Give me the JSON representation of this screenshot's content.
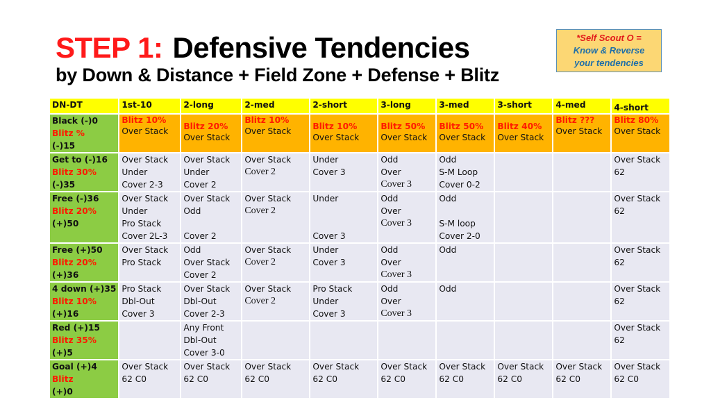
{
  "header": {
    "step": "STEP 1:",
    "title": "Defensive Tendencies",
    "subtitle": "by Down & Distance + Field Zone + Defense + Blitz"
  },
  "note": {
    "line1": "*Self Scout O =",
    "line2": "Know & Reverse",
    "line3": "your tendencies"
  },
  "colors": {
    "header_row": "#ffff00",
    "blitz_row": "#ffb300",
    "row_label": "#8ccc44",
    "cell": "#e8e8f2",
    "blitz_text": "#ff1a00",
    "title_step": "#ff1a1a"
  },
  "table": {
    "columns": [
      "DN-DT",
      "1st-10",
      "2-long",
      "2-med",
      "2-short",
      "3-long",
      "3-med",
      "3-short",
      "4-med",
      "4-short"
    ],
    "rows": [
      {
        "zone": "Black (-)0",
        "blitz": "Blitz %",
        "range": "(-)15",
        "cells": [
          [
            "Blitz 10%",
            "Over Stack"
          ],
          [
            "Blitz 20%",
            "Over Stack"
          ],
          [
            "Blitz 10%",
            "Over Stack"
          ],
          [
            "Blitz 10%",
            "Over Stack"
          ],
          [
            "Blitz 50%",
            "Over Stack"
          ],
          [
            "Blitz 50%",
            "Over Stack"
          ],
          [
            "Blitz 40%",
            "Over Stack"
          ],
          [
            "Blitz ???",
            "Over Stack"
          ],
          [
            "Blitz 80%",
            "Over Stack"
          ]
        ]
      },
      {
        "zone": "Get to (-)16",
        "blitz": "Blitz 30%",
        "range": "(-)35",
        "cells": [
          [
            "Over Stack",
            "Under",
            "Cover 2-3"
          ],
          [
            "Over Stack",
            "Under",
            "Cover 2"
          ],
          [
            "Over Stack",
            "Cover 2"
          ],
          [
            "Under",
            "Cover 3"
          ],
          [
            "Odd",
            "Over",
            "Cover 3"
          ],
          [
            "Odd",
            "S-M Loop",
            "Cover 0-2"
          ],
          [],
          [],
          [
            "Over Stack",
            "62"
          ]
        ]
      },
      {
        "zone": "Free (-)36",
        "blitz": "Blitz 20%",
        "range": "(+)50",
        "cells": [
          [
            "Over Stack",
            "Under",
            "Pro Stack",
            "Cover 2L-3"
          ],
          [
            "Over Stack",
            "Odd",
            "",
            "Cover 2"
          ],
          [
            "Over Stack",
            "Cover 2"
          ],
          [
            "Under",
            "",
            "",
            "Cover 3"
          ],
          [
            "Odd",
            "Over",
            "Cover 3"
          ],
          [
            "Odd",
            "",
            "S-M loop",
            "Cover 2-0"
          ],
          [],
          [],
          [
            "Over Stack",
            "62"
          ]
        ]
      },
      {
        "zone": "Free (+)50",
        "blitz": "Blitz 20%",
        "range": "(+)36",
        "cells": [
          [
            "Over Stack",
            "Pro Stack"
          ],
          [
            "Odd",
            "Over Stack",
            "Cover 2"
          ],
          [
            "Over Stack",
            "Cover 2"
          ],
          [
            "Under",
            "Cover 3"
          ],
          [
            "Odd",
            "Over",
            "Cover 3"
          ],
          [
            "Odd"
          ],
          [],
          [],
          [
            "Over Stack",
            "62"
          ]
        ]
      },
      {
        "zone": "4 down (+)35",
        "blitz": "Blitz 10%",
        "range": "(+)16",
        "cells": [
          [
            "Pro Stack",
            "Dbl-Out",
            "Cover 3"
          ],
          [
            "Over Stack",
            "Dbl-Out",
            "Cover 2-3"
          ],
          [
            "Over Stack",
            "Cover 2"
          ],
          [
            "Pro Stack",
            "Under",
            "Cover 3"
          ],
          [
            "Odd",
            "Over",
            "Cover 3"
          ],
          [
            "Odd"
          ],
          [],
          [],
          [
            "Over Stack",
            "62"
          ]
        ]
      },
      {
        "zone": "Red (+)15",
        "blitz": "Blitz 35%",
        "range": " (+)5",
        "cells": [
          [],
          [
            "Any Front",
            "Dbl-Out",
            "Cover 3-0"
          ],
          [],
          [],
          [],
          [],
          [],
          [],
          [
            "Over Stack",
            "62"
          ]
        ]
      },
      {
        "zone": "Goal (+)4",
        "blitz": "Blitz",
        "range": "(+)0",
        "cells": [
          [
            "Over Stack",
            "62 C0"
          ],
          [
            "Over Stack",
            "62 C0"
          ],
          [
            "Over Stack",
            "62 C0"
          ],
          [
            "Over Stack",
            "62 C0"
          ],
          [
            "Over Stack",
            "62 C0"
          ],
          [
            "Over Stack",
            "62 C0"
          ],
          [
            "Over Stack",
            "62 C0"
          ],
          [
            "Over Stack",
            "62 C0"
          ],
          [
            "Over Stack",
            "62 C0"
          ]
        ]
      }
    ]
  }
}
